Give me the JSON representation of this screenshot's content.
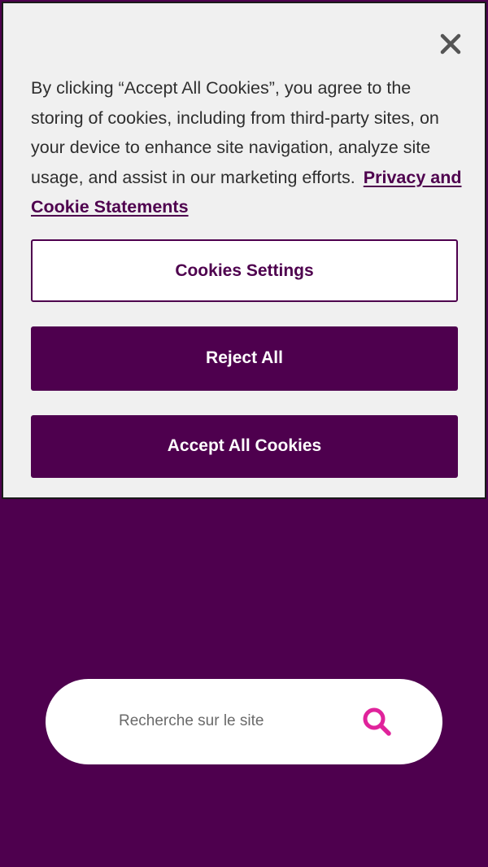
{
  "cookie_banner": {
    "message": "By clicking “Accept All Cookies”, you agree to the storing of cookies, including from third-party sites, on your device to enhance site navigation, analyze site usage, and assist in our marketing efforts.",
    "privacy_link": "Privacy and Cookie Statements",
    "settings_label": "Cookies Settings",
    "reject_label": "Reject All",
    "accept_label": "Accept All Cookies",
    "close_icon": "close-icon"
  },
  "search": {
    "placeholder": "Recherche sur le site",
    "value": "",
    "icon": "search-icon"
  },
  "colors": {
    "brand_purple": "#4e004e",
    "search_icon": "#e0239b",
    "banner_bg": "#f0f0f0"
  }
}
